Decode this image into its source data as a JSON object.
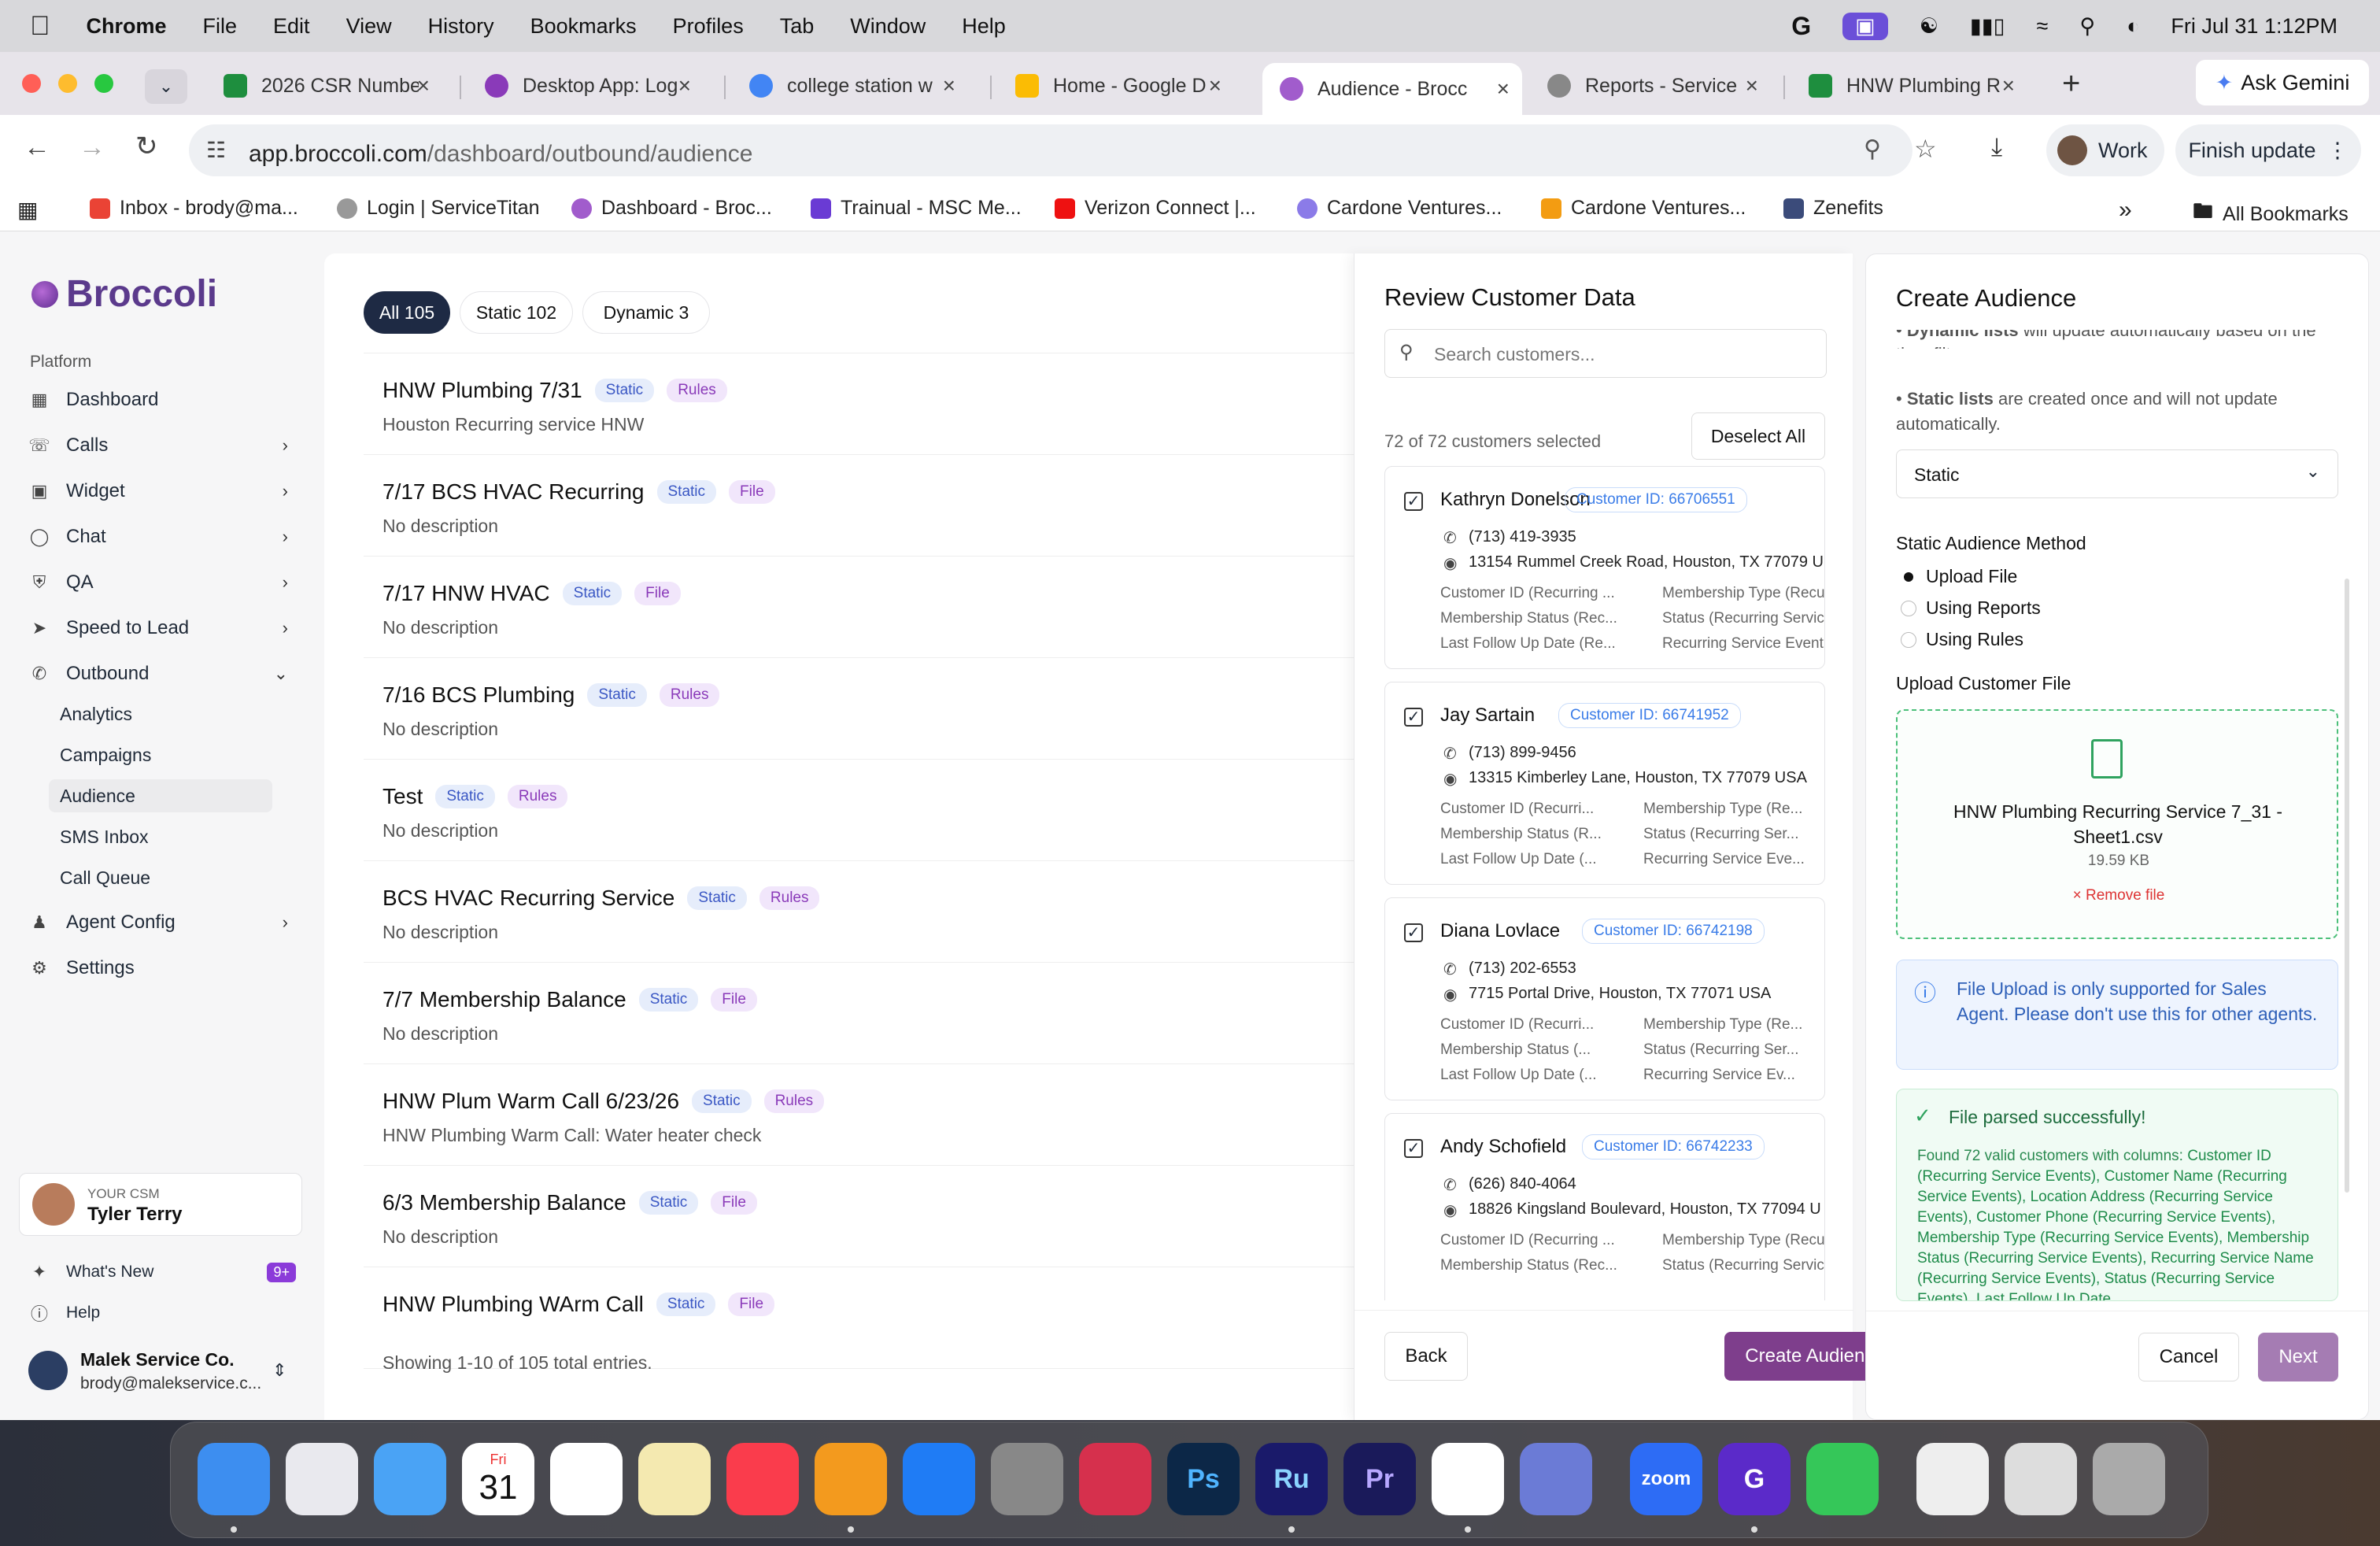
{
  "menubar": {
    "app": "Chrome",
    "items": [
      "File",
      "Edit",
      "View",
      "History",
      "Bookmarks",
      "Profiles",
      "Tab",
      "Window",
      "Help"
    ],
    "datetime": "Fri Jul 31  1:12PM"
  },
  "tabs": [
    {
      "title": "2026 CSR Numbe",
      "color": "#1e8e3e"
    },
    {
      "title": "Desktop App: Log",
      "color": "#8a3ab9"
    },
    {
      "title": "college station w",
      "color": "#4285f4"
    },
    {
      "title": "Home - Google D",
      "color": "#fbbc04"
    },
    {
      "title": "Audience - Brocc",
      "color": "#a15ccc"
    },
    {
      "title": "Reports - Service",
      "color": "#777"
    },
    {
      "title": "HNW Plumbing R",
      "color": "#1e8e3e"
    }
  ],
  "gemini": "Ask Gemini",
  "address": {
    "host": "app.broccoli.com",
    "path": "/dashboard/outbound/audience",
    "profile": "Work",
    "update": "Finish update"
  },
  "bookmarks": [
    "Inbox - brody@ma...",
    "Login | ServiceTitan",
    "Dashboard - Broc...",
    "Trainual - MSC Me...",
    "Verizon Connect |...",
    "Cardone Ventures...",
    "Cardone Ventures...",
    "Zenefits",
    "All Bookmarks"
  ],
  "sidebar": {
    "logo": "Broccoli",
    "section": "Platform",
    "items": [
      "Dashboard",
      "Calls",
      "Widget",
      "Chat",
      "QA",
      "Speed to Lead",
      "Outbound",
      "Agent Config",
      "Settings"
    ],
    "outbound_sub": [
      "Analytics",
      "Campaigns",
      "Audience",
      "SMS Inbox",
      "Call Queue"
    ],
    "csm_label": "YOUR CSM",
    "csm_name": "Tyler Terry",
    "whats_new": "What's New",
    "whats_new_badge": "9+",
    "help": "Help",
    "account_name": "Malek Service Co.",
    "account_email": "brody@malekservice.c..."
  },
  "filters": [
    "All 105",
    "Static 102",
    "Dynamic 3"
  ],
  "audiences": [
    {
      "name": "HNW Plumbing 7/31",
      "type": "Static",
      "source": "Rules",
      "desc": "Houston Recurring service HNW"
    },
    {
      "name": "7/17 BCS HVAC Recurring",
      "type": "Static",
      "source": "File",
      "desc": "No description"
    },
    {
      "name": "7/17 HNW HVAC",
      "type": "Static",
      "source": "File",
      "desc": "No description"
    },
    {
      "name": "7/16 BCS Plumbing",
      "type": "Static",
      "source": "Rules",
      "desc": "No description"
    },
    {
      "name": "Test",
      "type": "Static",
      "source": "Rules",
      "desc": "No description"
    },
    {
      "name": "BCS HVAC Recurring Service",
      "type": "Static",
      "source": "Rules",
      "desc": "No description"
    },
    {
      "name": "7/7 Membership Balance",
      "type": "Static",
      "source": "File",
      "desc": "No description"
    },
    {
      "name": "HNW Plum Warm Call 6/23/26",
      "type": "Static",
      "source": "Rules",
      "desc": "HNW Plumbing Warm Call: Water heater check"
    },
    {
      "name": "6/3 Membership Balance",
      "type": "Static",
      "source": "File",
      "desc": "No description"
    },
    {
      "name": "HNW Plumbing WArm Call",
      "type": "Static",
      "source": "File",
      "desc": ""
    }
  ],
  "list_footer": "Showing 1-10 of 105 total entries.",
  "review": {
    "title": "Review Customer Data",
    "search_placeholder": "Search customers...",
    "selected": "72 of 72 customers selected",
    "deselect": "Deselect All",
    "back": "Back",
    "create": "Create Audience",
    "customers": [
      {
        "name": "Kathryn Donelson",
        "id": "Customer ID: 66706551",
        "phone": "(713) 419-3935",
        "address": "13154 Rummel Creek Road, Houston, TX 77079 US",
        "fields": [
          "Customer ID (Recurring ...",
          "Membership Type (Recu",
          "Membership Status (Rec...",
          "Status (Recurring Servic",
          "Last Follow Up Date (Re...",
          "Recurring Service Event"
        ]
      },
      {
        "name": "Jay Sartain",
        "id": "Customer ID: 66741952",
        "phone": "(713) 899-9456",
        "address": "13315 Kimberley Lane, Houston, TX 77079 USA",
        "fields": [
          "Customer ID (Recurri...",
          "Membership Type (Re...",
          "Membership Status (R...",
          "Status (Recurring Ser...",
          "Last Follow Up Date (...",
          "Recurring Service Eve..."
        ]
      },
      {
        "name": "Diana Lovlace",
        "id": "Customer ID: 66742198",
        "phone": "(713) 202-6553",
        "address": "7715 Portal Drive, Houston, TX 77071 USA",
        "fields": [
          "Customer ID (Recurri...",
          "Membership Type (Re...",
          "Membership Status (...",
          "Status (Recurring Ser...",
          "Last Follow Up Date (...",
          "Recurring Service Ev..."
        ]
      },
      {
        "name": "Andy Schofield",
        "id": "Customer ID: 66742233",
        "phone": "(626) 840-4064",
        "address": "18826 Kingsland Boulevard, Houston, TX 77094 U",
        "fields": [
          "Customer ID (Recurring ...",
          "Membership Type (Recu",
          "Membership Status (Rec...",
          "Status (Recurring Servic"
        ]
      }
    ]
  },
  "create": {
    "title": "Create Audience",
    "dynamic_lead": "Dynamic lists",
    "dynamic_text": " will update automatically based on the time filter.",
    "static_lead": "Static lists",
    "static_text": " are created once and will not update automatically.",
    "select_value": "Static",
    "method_label": "Static Audience Method",
    "methods": [
      "Upload File",
      "Using Reports",
      "Using Rules"
    ],
    "upload_label": "Upload Customer File",
    "file_name": "HNW Plumbing Recurring Service 7_31 - Sheet1.csv",
    "file_size": "19.59 KB",
    "remove": "Remove file",
    "info": "File Upload is only supported for Sales Agent. Please don't use this for other agents.",
    "success_title": "File parsed successfully!",
    "success_lead": "Found 72 valid customers with columns: ",
    "success_cols": "Customer ID (Recurring Service Events), Customer Name (Recurring Service Events), Location Address (Recurring Service Events), Customer Phone (Recurring Service Events), Membership Type (Recurring Service Events), Membership Status (Recurring Service Events), Recurring Service Name (Recurring Service Events), Status (Recurring Service Events), Last Follow Up Date",
    "cancel": "Cancel",
    "next": "Next"
  },
  "dock": [
    "Finder",
    "Launchpad",
    "Mail",
    "Calendar",
    "Photos",
    "Notes",
    "Music",
    "Pages",
    "App Store",
    "System Settings",
    "Creative Cloud",
    "Photoshop",
    "Rush",
    "Premiere Pro",
    "Chrome",
    "Simulator",
    "Zoom",
    "Gemini",
    "Phone",
    "Preview",
    "Chrome Window",
    "Trash"
  ],
  "calendar": {
    "month": "Fri",
    "day": "31"
  }
}
